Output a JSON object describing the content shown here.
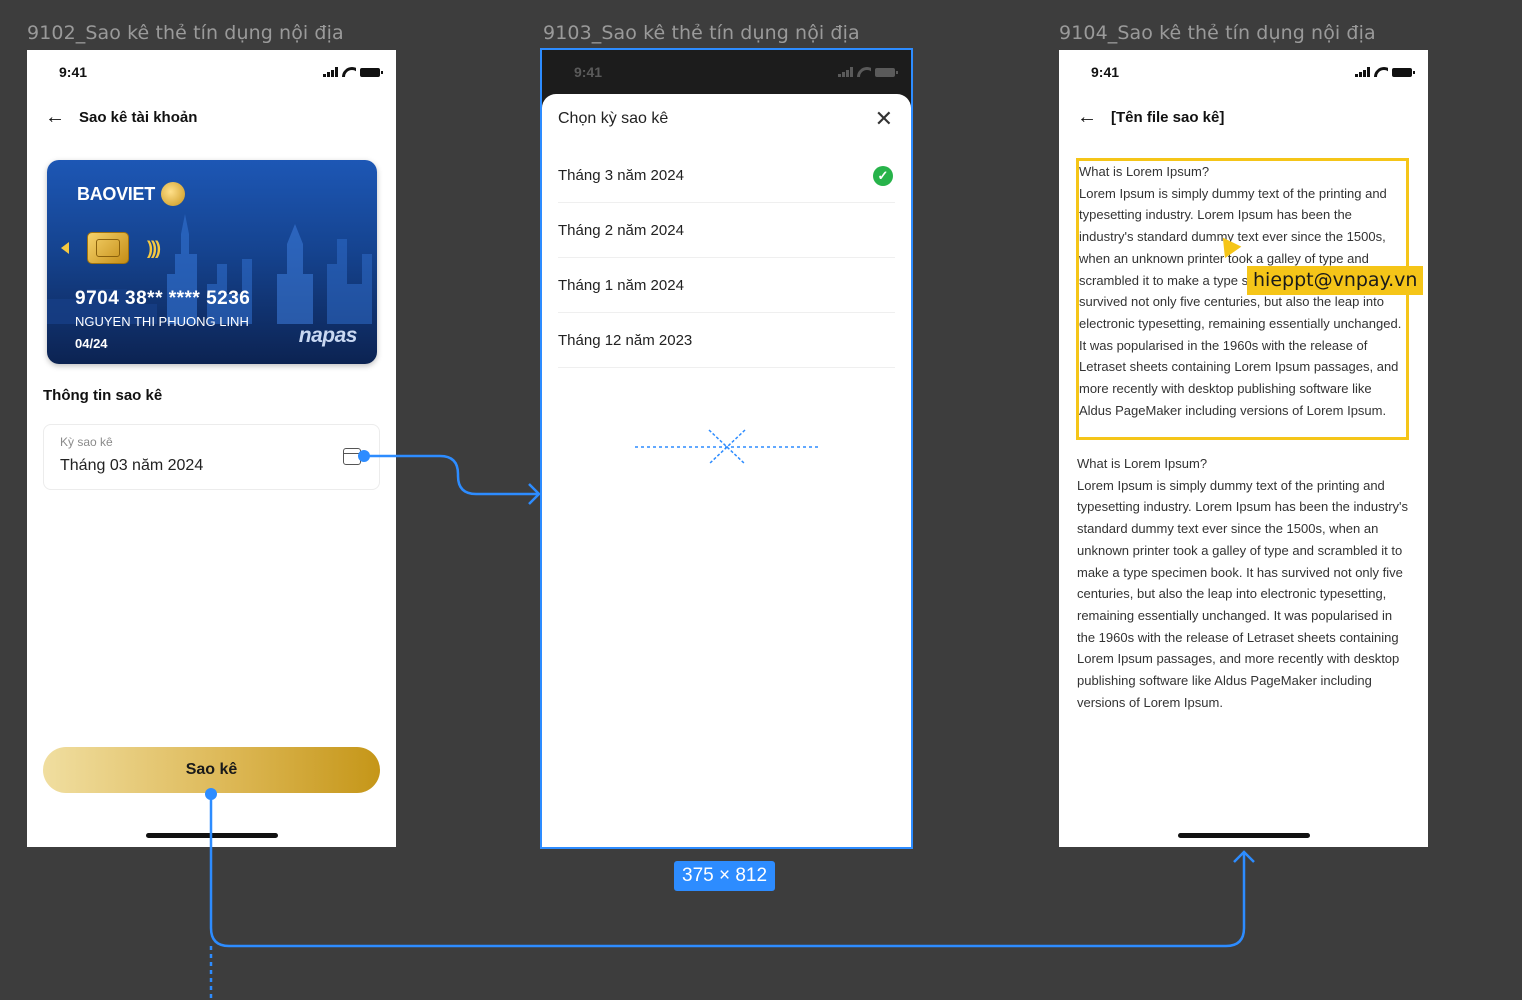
{
  "frames": [
    {
      "label": "9102_Sao kê thẻ tín dụng nội địa"
    },
    {
      "label": "9103_Sao kê thẻ tín dụng nội địa"
    },
    {
      "label": "9104_Sao kê thẻ tín dụng nội địa"
    }
  ],
  "status": {
    "time": "9:41"
  },
  "screen1": {
    "title": "Sao kê tài khoản",
    "card": {
      "brand": "BAOVIET",
      "number": "9704 38** **** 5236",
      "holder": "NGUYEN THI PHUONG LINH",
      "expiry": "04/24",
      "network": "napas"
    },
    "section_title": "Thông tin sao kê",
    "field": {
      "label": "Kỳ sao kê",
      "value": "Tháng 03 năm 2024"
    },
    "button": "Sao kê"
  },
  "screen2": {
    "title": "Chọn kỳ sao kê",
    "options": [
      {
        "label": "Tháng 3 năm 2024",
        "selected": true
      },
      {
        "label": "Tháng 2 năm 2024",
        "selected": false
      },
      {
        "label": "Tháng 1 năm 2024",
        "selected": false
      },
      {
        "label": "Tháng 12 năm 2023",
        "selected": false
      }
    ],
    "size_badge": "375 × 812"
  },
  "screen3": {
    "title": "[Tên file sao kê]",
    "paragraph_1": "What is Lorem Ipsum?\nLorem Ipsum is simply dummy text of the printing and typesetting industry. Lorem Ipsum has been the industry's standard  dummy text ever since the 1500s, when an unknown printer took a galley  of type and scrambled it to make a type specimen book. It has survived  not only five centuries, but also the leap into electronic typesetting,  remaining essentially unchanged. It was popularised in the 1960s with  the release of Letraset sheets containing Lorem Ipsum passages, and more  recently with desktop publishing software like Aldus PageMaker  including versions of Lorem Ipsum.",
    "paragraph_2": "What is Lorem Ipsum?\nLorem Ipsum is simply dummy text of the printing and typesetting industry. Lorem Ipsum has been the industry's standard  dummy text ever since the 1500s, when an unknown printer took a galley  of type and scrambled it to make a type specimen book. It has survived  not only five centuries, but also the leap into electronic typesetting,  remaining essentially unchanged. It was popularised in the 1960s with  the release of Letraset sheets containing Lorem Ipsum passages, and more  recently with desktop publishing software like Aldus PageMaker  including versions of Lorem Ipsum.",
    "collaborator": "hieppt@vnpay.vn"
  },
  "colors": {
    "canvas": "#3d3d3d",
    "flow_line": "#2d8cff",
    "gold_start": "#f0dea0",
    "gold_end": "#c59618",
    "success": "#27b34a",
    "highlight": "#f5c518"
  }
}
